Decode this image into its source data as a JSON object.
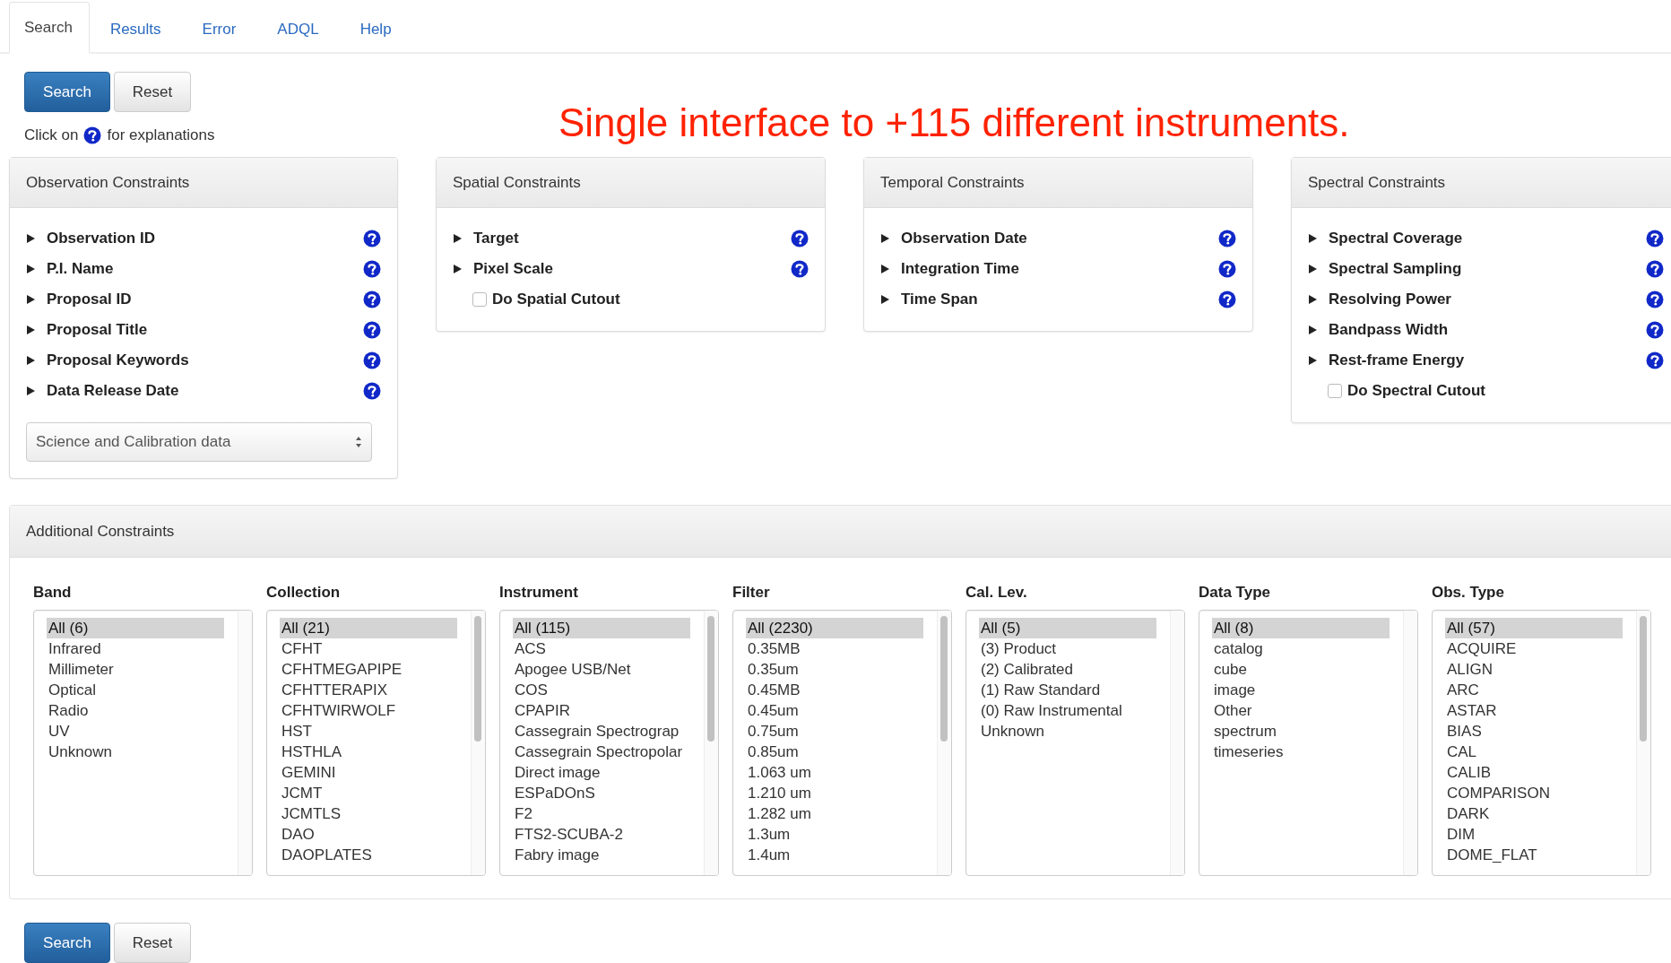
{
  "tabs": [
    {
      "label": "Search",
      "selected": true
    },
    {
      "label": "Results",
      "selected": false
    },
    {
      "label": "Error",
      "selected": false
    },
    {
      "label": "ADQL",
      "selected": false
    },
    {
      "label": "Help",
      "selected": false
    }
  ],
  "actions": {
    "search": "Search",
    "reset": "Reset"
  },
  "hint": {
    "before": "Click on",
    "after": "for explanations"
  },
  "headline": "Single interface to +115 different instruments.",
  "panels": [
    {
      "title": "Observation Constraints",
      "rows": [
        {
          "kind": "expander",
          "label": "Observation ID",
          "expanded": false
        },
        {
          "kind": "expander",
          "label": "P.I. Name",
          "expanded": false
        },
        {
          "kind": "expander",
          "label": "Proposal ID",
          "expanded": false
        },
        {
          "kind": "expander",
          "label": "Proposal Title",
          "expanded": false
        },
        {
          "kind": "expander",
          "label": "Proposal Keywords",
          "expanded": false
        },
        {
          "kind": "expander",
          "label": "Data Release Date",
          "expanded": false
        }
      ],
      "select": {
        "value": "Science and Calibration data"
      }
    },
    {
      "title": "Spatial Constraints",
      "rows": [
        {
          "kind": "expander",
          "label": "Target",
          "expanded": false
        },
        {
          "kind": "expander",
          "label": "Pixel Scale",
          "expanded": false
        },
        {
          "kind": "checkbox",
          "label": "Do Spatial Cutout",
          "checked": false
        }
      ]
    },
    {
      "title": "Temporal Constraints",
      "rows": [
        {
          "kind": "expander",
          "label": "Observation Date",
          "expanded": false
        },
        {
          "kind": "expander",
          "label": "Integration Time",
          "expanded": false
        },
        {
          "kind": "expander",
          "label": "Time Span",
          "expanded": false
        }
      ]
    },
    {
      "title": "Spectral Constraints",
      "rows": [
        {
          "kind": "expander",
          "label": "Spectral Coverage",
          "expanded": false
        },
        {
          "kind": "expander",
          "label": "Spectral Sampling",
          "expanded": false
        },
        {
          "kind": "expander",
          "label": "Resolving Power",
          "expanded": false
        },
        {
          "kind": "expander",
          "label": "Bandpass Width",
          "expanded": false
        },
        {
          "kind": "expander",
          "label": "Rest-frame Energy",
          "expanded": false
        },
        {
          "kind": "checkbox",
          "label": "Do Spectral Cutout",
          "checked": false
        }
      ]
    }
  ],
  "additional": {
    "title": "Additional Constraints",
    "lists": [
      {
        "label": "Band",
        "scrollable": false,
        "items": [
          {
            "text": "All (6)",
            "selected": true
          },
          {
            "text": "Infrared",
            "selected": false
          },
          {
            "text": "Millimeter",
            "selected": false
          },
          {
            "text": "Optical",
            "selected": false
          },
          {
            "text": "Radio",
            "selected": false
          },
          {
            "text": "UV",
            "selected": false
          },
          {
            "text": "Unknown",
            "selected": false
          }
        ]
      },
      {
        "label": "Collection",
        "scrollable": true,
        "items": [
          {
            "text": "All (21)",
            "selected": true
          },
          {
            "text": "CFHT",
            "selected": false
          },
          {
            "text": "CFHTMEGAPIPE",
            "selected": false
          },
          {
            "text": "CFHTTERAPIX",
            "selected": false
          },
          {
            "text": "CFHTWIRWOLF",
            "selected": false
          },
          {
            "text": "HST",
            "selected": false
          },
          {
            "text": "HSTHLA",
            "selected": false
          },
          {
            "text": "GEMINI",
            "selected": false
          },
          {
            "text": "JCMT",
            "selected": false
          },
          {
            "text": "JCMTLS",
            "selected": false
          },
          {
            "text": "DAO",
            "selected": false
          },
          {
            "text": "DAOPLATES",
            "selected": false
          }
        ]
      },
      {
        "label": "Instrument",
        "scrollable": true,
        "items": [
          {
            "text": "All (115)",
            "selected": true
          },
          {
            "text": "ACS",
            "selected": false
          },
          {
            "text": "Apogee USB/Net",
            "selected": false
          },
          {
            "text": "COS",
            "selected": false
          },
          {
            "text": "CPAPIR",
            "selected": false
          },
          {
            "text": "Cassegrain Spectrograp",
            "selected": false
          },
          {
            "text": "Cassegrain Spectropolar",
            "selected": false
          },
          {
            "text": "Direct image",
            "selected": false
          },
          {
            "text": "ESPaDOnS",
            "selected": false
          },
          {
            "text": "F2",
            "selected": false
          },
          {
            "text": "FTS2-SCUBA-2",
            "selected": false
          },
          {
            "text": "Fabry image",
            "selected": false
          }
        ]
      },
      {
        "label": "Filter",
        "scrollable": true,
        "items": [
          {
            "text": "All (2230)",
            "selected": true
          },
          {
            "text": "0.35MB",
            "selected": false
          },
          {
            "text": "0.35um",
            "selected": false
          },
          {
            "text": "0.45MB",
            "selected": false
          },
          {
            "text": "0.45um",
            "selected": false
          },
          {
            "text": "0.75um",
            "selected": false
          },
          {
            "text": "0.85um",
            "selected": false
          },
          {
            "text": "1.063 um",
            "selected": false
          },
          {
            "text": "1.210 um",
            "selected": false
          },
          {
            "text": "1.282 um",
            "selected": false
          },
          {
            "text": "1.3um",
            "selected": false
          },
          {
            "text": "1.4um",
            "selected": false
          }
        ]
      },
      {
        "label": "Cal. Lev.",
        "scrollable": false,
        "items": [
          {
            "text": "All (5)",
            "selected": true
          },
          {
            "text": "(3) Product",
            "selected": false
          },
          {
            "text": "(2) Calibrated",
            "selected": false
          },
          {
            "text": "(1) Raw Standard",
            "selected": false
          },
          {
            "text": "(0) Raw Instrumental",
            "selected": false
          },
          {
            "text": "Unknown",
            "selected": false
          }
        ]
      },
      {
        "label": "Data Type",
        "scrollable": false,
        "items": [
          {
            "text": "All (8)",
            "selected": true
          },
          {
            "text": "catalog",
            "selected": false
          },
          {
            "text": "cube",
            "selected": false
          },
          {
            "text": "image",
            "selected": false
          },
          {
            "text": "Other",
            "selected": false
          },
          {
            "text": "spectrum",
            "selected": false
          },
          {
            "text": "timeseries",
            "selected": false
          }
        ]
      },
      {
        "label": "Obs. Type",
        "scrollable": true,
        "items": [
          {
            "text": "All (57)",
            "selected": true
          },
          {
            "text": "ACQUIRE",
            "selected": false
          },
          {
            "text": "ALIGN",
            "selected": false
          },
          {
            "text": "ARC",
            "selected": false
          },
          {
            "text": "ASTAR",
            "selected": false
          },
          {
            "text": "BIAS",
            "selected": false
          },
          {
            "text": "CAL",
            "selected": false
          },
          {
            "text": "CALIB",
            "selected": false
          },
          {
            "text": "COMPARISON",
            "selected": false
          },
          {
            "text": "DARK",
            "selected": false
          },
          {
            "text": "DIM",
            "selected": false
          },
          {
            "text": "DOME_FLAT",
            "selected": false
          }
        ]
      }
    ]
  },
  "bottom_actions": {
    "search": "Search",
    "reset": "Reset"
  }
}
